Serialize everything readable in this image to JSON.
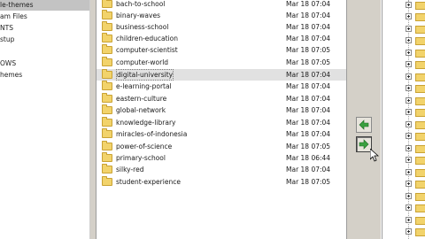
{
  "left_tree": {
    "items": [
      "le-themes",
      "am Files",
      "NTS",
      "stup",
      "",
      "OWS",
      "hemes"
    ]
  },
  "file_list": {
    "rows": [
      {
        "name": "bach-to-school",
        "date": "Mar 18 07:04"
      },
      {
        "name": "binary-waves",
        "date": "Mar 18 07:04"
      },
      {
        "name": "business-school",
        "date": "Mar 18 07:04"
      },
      {
        "name": "children-education",
        "date": "Mar 18 07:04"
      },
      {
        "name": "computer-scientist",
        "date": "Mar 18 07:05"
      },
      {
        "name": "computer-world",
        "date": "Mar 18 07:05"
      },
      {
        "name": "digital-university",
        "date": "Mar 18 07:04",
        "selected": true
      },
      {
        "name": "e-learning-portal",
        "date": "Mar 18 07:04"
      },
      {
        "name": "eastern-culture",
        "date": "Mar 18 07:04"
      },
      {
        "name": "global-network",
        "date": "Mar 18 07:04"
      },
      {
        "name": "knowledge-library",
        "date": "Mar 18 07:04"
      },
      {
        "name": "miracles-of-indonesia",
        "date": "Mar 18 07:04"
      },
      {
        "name": "power-of-science",
        "date": "Mar 18 07:05"
      },
      {
        "name": "primary-school",
        "date": "Mar 18 06:44"
      },
      {
        "name": "silky-red",
        "date": "Mar 18 07:04"
      },
      {
        "name": "student-experience",
        "date": "Mar 18 07:05"
      }
    ]
  },
  "buttons": {
    "copy_left": "arrow-left-icon",
    "copy_right": "arrow-right-icon"
  },
  "colors": {
    "arrow_green": "#3aa040",
    "folder_yellow": "#f2d36b",
    "selection_gray": "#e1e1e1"
  }
}
